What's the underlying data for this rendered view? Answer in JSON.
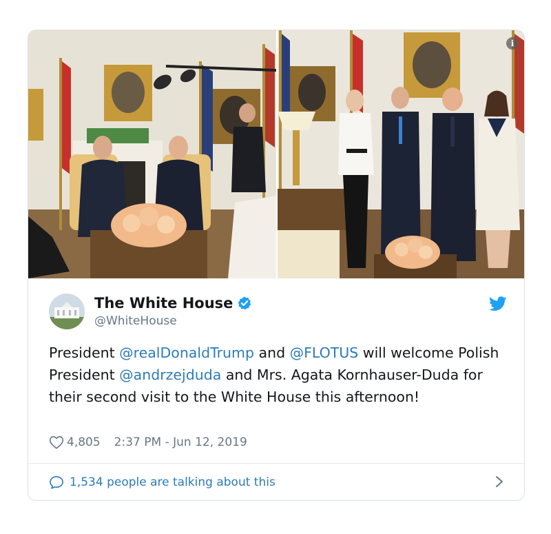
{
  "tweet": {
    "display_name": "The White House",
    "handle": "@WhiteHouse",
    "text_segments": [
      {
        "text": "President ",
        "mention": false
      },
      {
        "text": "@realDonaldTrump",
        "mention": true
      },
      {
        "text": " and ",
        "mention": false
      },
      {
        "text": "@FLOTUS",
        "mention": true
      },
      {
        "text": " will welcome Polish President ",
        "mention": false
      },
      {
        "text": "@andrzejduda",
        "mention": true
      },
      {
        "text": " and Mrs. Agata Kornhauser-Duda for their second visit to the White House this afternoon!",
        "mention": false
      }
    ],
    "likes": "4,805",
    "timestamp": "2:37 PM - Jun 12, 2019",
    "talking": "1,534 people are talking about this"
  },
  "icons": {
    "info": "info-icon",
    "verified": "verified-badge-icon",
    "bird": "twitter-bird-icon",
    "heart": "heart-icon",
    "bubble": "speech-bubble-icon",
    "chevron": "chevron-right-icon"
  },
  "colors": {
    "link": "#2b7bb9",
    "verified": "#1da1f2",
    "text": "#14171a",
    "muted": "#657786"
  }
}
